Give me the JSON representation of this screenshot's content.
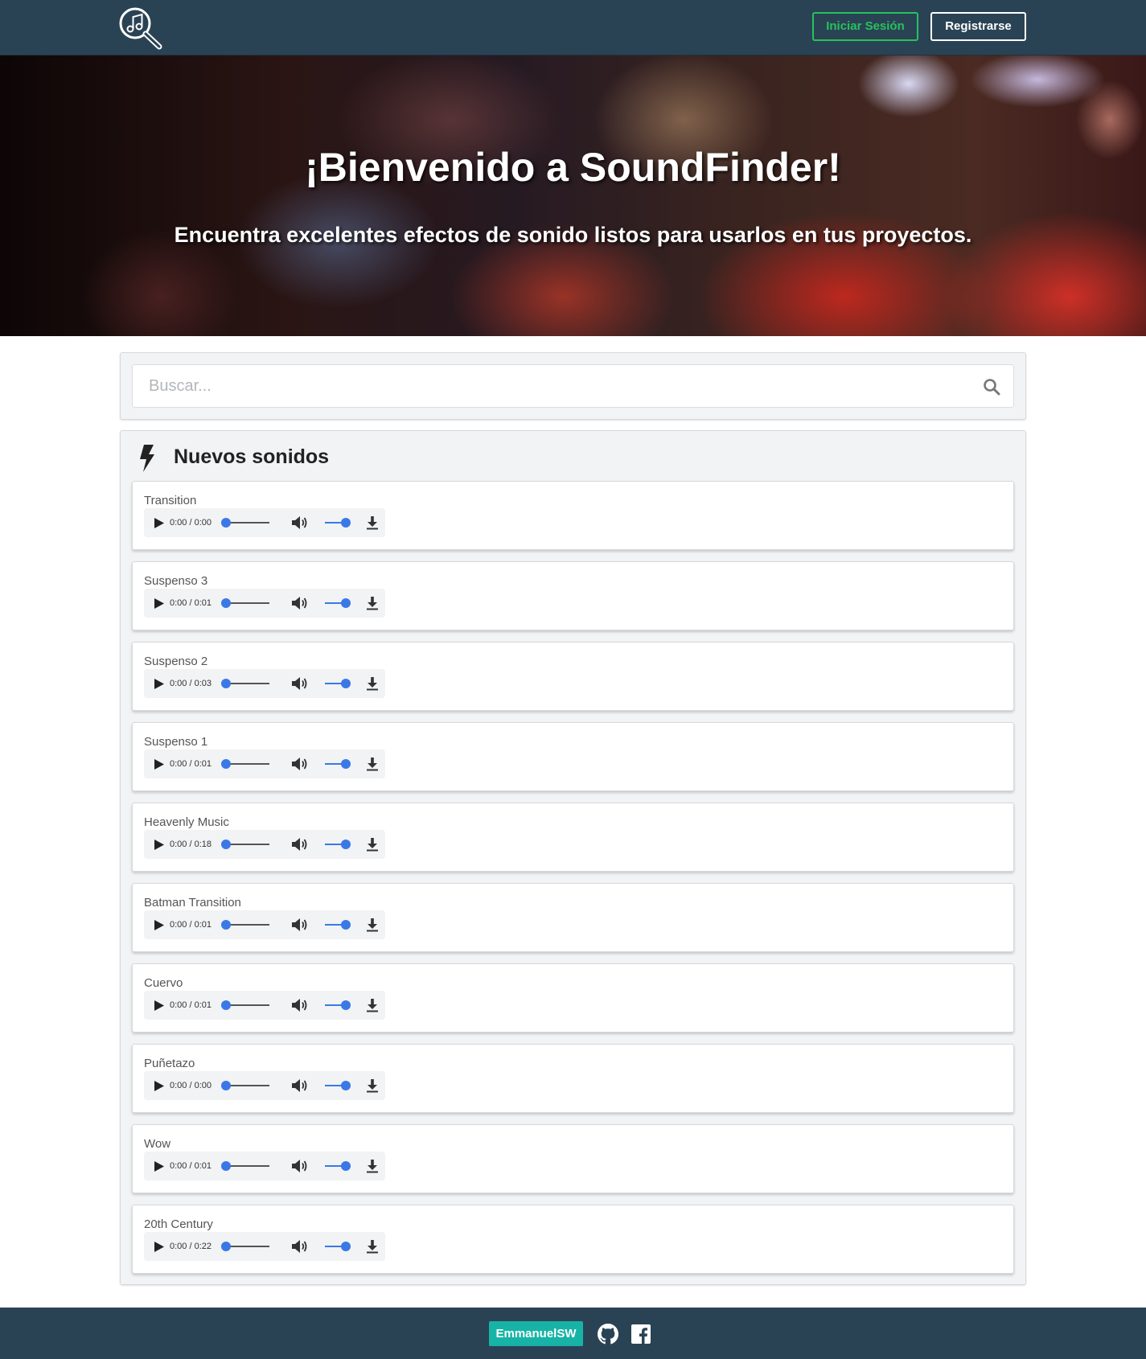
{
  "header": {
    "login_label": "Iniciar Sesión",
    "register_label": "Registrarse",
    "logo_icon": "music-search-icon"
  },
  "hero": {
    "title": "¡Bienvenido a SoundFinder!",
    "subtitle": "Encuentra excelentes efectos de sonido listos para usarlos en tus proyectos."
  },
  "search": {
    "placeholder": "Buscar...",
    "icon": "search-icon"
  },
  "sounds_section": {
    "title": "Nuevos sonidos",
    "icon": "lightning-bolt-icon",
    "items": [
      {
        "name": "Transition",
        "time": "0:00 / 0:00"
      },
      {
        "name": "Suspenso 3",
        "time": "0:00 / 0:01"
      },
      {
        "name": "Suspenso 2",
        "time": "0:00 / 0:03"
      },
      {
        "name": "Suspenso 1",
        "time": "0:00 / 0:01"
      },
      {
        "name": "Heavenly Music",
        "time": "0:00 / 0:18"
      },
      {
        "name": "Batman Transition",
        "time": "0:00 / 0:01"
      },
      {
        "name": "Cuervo",
        "time": "0:00 / 0:01"
      },
      {
        "name": "Puñetazo",
        "time": "0:00 / 0:00"
      },
      {
        "name": "Wow",
        "time": "0:00 / 0:01"
      },
      {
        "name": "20th Century",
        "time": "0:00 / 0:22"
      }
    ]
  },
  "footer": {
    "author_label": "EmmanuelSW",
    "icons": [
      "github-icon",
      "facebook-icon"
    ]
  },
  "colors": {
    "navbar": "#2a4354",
    "login_green": "#27c15c",
    "footer_badge": "#17b3a6",
    "player_accent": "#3b78e7"
  }
}
